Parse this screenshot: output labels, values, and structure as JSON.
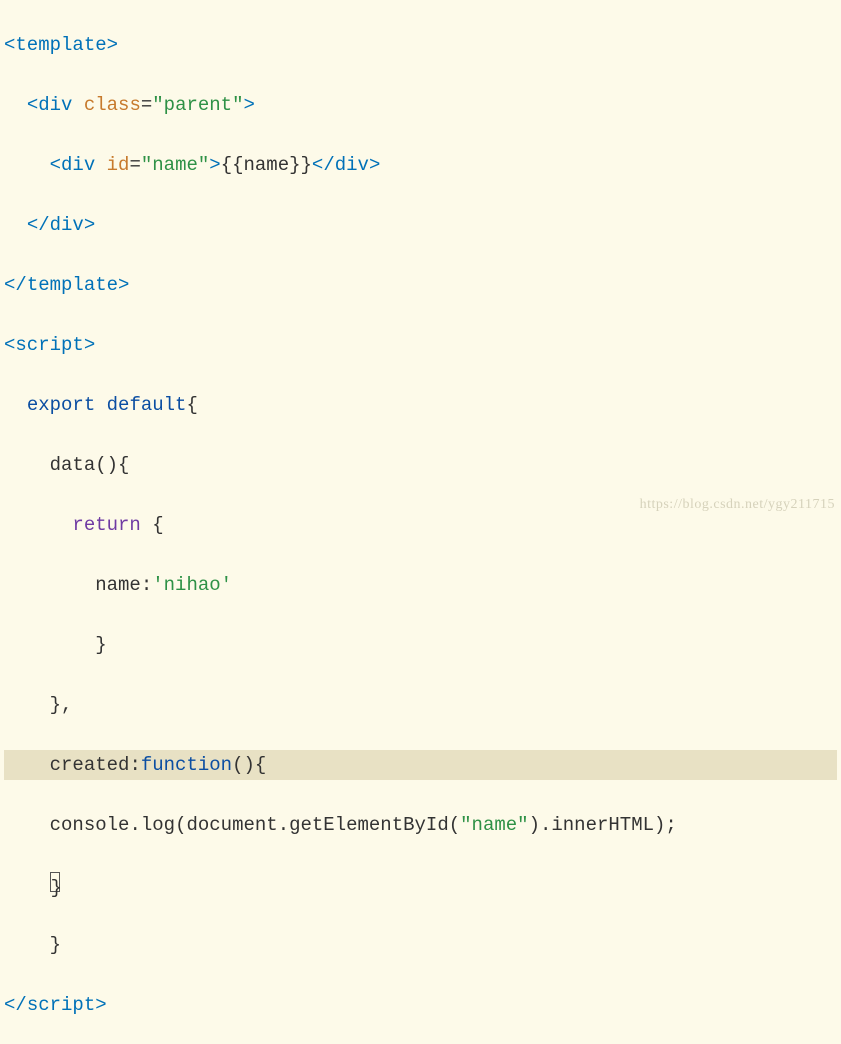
{
  "code": {
    "l1": {
      "open": "<",
      "template": "template",
      "close": ">"
    },
    "l2": {
      "indent": "  ",
      "open": "<",
      "div": "div",
      "sp": " ",
      "class": "class",
      "eq": "=",
      "q": "\"",
      "parent": "parent",
      "close": ">"
    },
    "l3": {
      "indent": "    ",
      "open": "<",
      "div": "div",
      "sp": " ",
      "id": "id",
      "eq": "=",
      "q": "\"",
      "name": "name",
      "close": ">",
      "mopen": "{{",
      "mname": "name",
      "mclose": "}}",
      "open2": "</",
      "close2": ">"
    },
    "l4": {
      "indent": "  ",
      "open": "</",
      "div": "div",
      "close": ">"
    },
    "l5": {
      "open": "</",
      "template": "template",
      "close": ">"
    },
    "l6": {
      "open": "<",
      "script": "script",
      "close": ">"
    },
    "l7": {
      "indent": "  ",
      "export": "export",
      "sp": " ",
      "default": "default",
      "brace": "{"
    },
    "l8": {
      "indent": "    ",
      "data": "data",
      "paren": "()",
      "brace": "{"
    },
    "l9": {
      "indent": "      ",
      "return": "return",
      "sp": " ",
      "brace": "{"
    },
    "l10": {
      "indent": "        ",
      "name": "name",
      "colon": ":",
      "q": "'",
      "val": "nihao"
    },
    "l11": {
      "indent": "        ",
      "brace": "}"
    },
    "l12": {
      "indent": "    ",
      "brace": "}",
      "comma": ","
    },
    "l13": {
      "indent": "    ",
      "created": "created",
      "colon": ":",
      "function": "function",
      "paren": "()",
      "brace": "{"
    },
    "l14": {
      "indent": "    ",
      "console": "console",
      "dot1": ".",
      "log": "log",
      "open": "(",
      "document": "document",
      "dot2": ".",
      "get": "getElementById",
      "open2": "(",
      "q": "\"",
      "name": "name",
      "close2": ")",
      "dot3": ".",
      "inner": "innerHTML",
      "close": ")",
      ";": ";"
    },
    "l15": {
      "indent": "    "
    },
    "l16": {
      "indent": "    ",
      "brace": "}"
    },
    "l17": {
      "open": "</",
      "script": "script",
      "close": ">"
    }
  },
  "watermark": "https://blog.csdn.net/ygy211715"
}
